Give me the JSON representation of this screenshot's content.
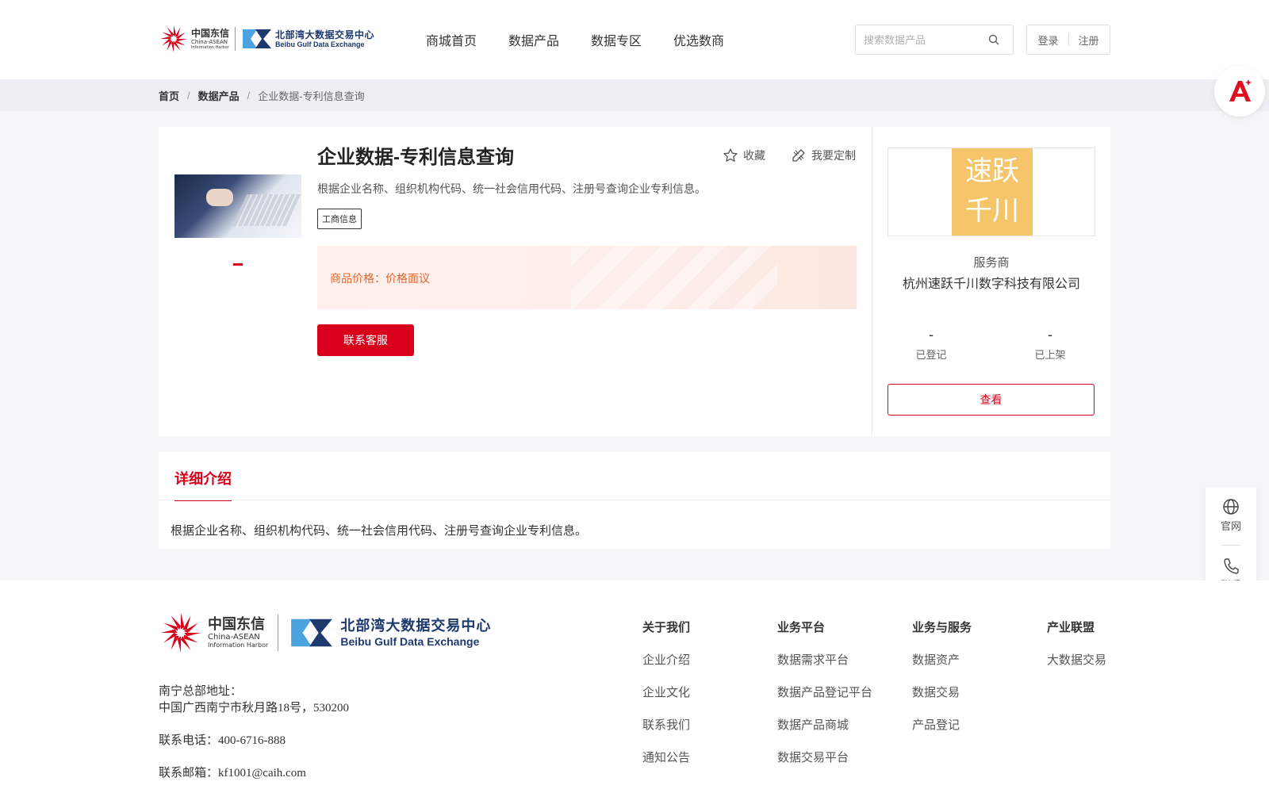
{
  "header": {
    "logo_cn": "中国东信",
    "logo_cn_sub": "China-ASEAN",
    "logo_cn_sub2": "Information Harbor",
    "logo_bb": "北部湾大数据交易中心",
    "logo_bb_en": "Beibu Gulf Data Exchange",
    "nav": [
      "商城首页",
      "数据产品",
      "数据专区",
      "优选数商"
    ],
    "search_placeholder": "搜索数据产品",
    "login": "登录",
    "register": "注册"
  },
  "breadcrumb": [
    "首页",
    "数据产品",
    "企业数据-专利信息查询"
  ],
  "product": {
    "title": "企业数据-专利信息查询",
    "favorite": "收藏",
    "customize": "我要定制",
    "description": "根据企业名称、组织机构代码、统一社会信用代码、注册号查询企业专利信息。",
    "tag": "工商信息",
    "price_label": "商品价格：",
    "price_value": "价格面议",
    "contact_button": "联系客服"
  },
  "provider": {
    "logo_line1": "速跃",
    "logo_line2": "千川",
    "label": "服务商",
    "name": "杭州速跃千川数字科技有限公司",
    "registered_value": "-",
    "registered_label": "已登记",
    "listed_value": "-",
    "listed_label": "已上架",
    "view_button": "查看"
  },
  "detail": {
    "tab": "详细介绍",
    "text": "根据企业名称、组织机构代码、统一社会信用代码、注册号查询企业专利信息。"
  },
  "side": {
    "website": "官网",
    "contact": "联系"
  },
  "footer": {
    "address_label": "南宁总部地址：",
    "address": "中国广西南宁市秋月路18号，530200",
    "phone": "联系电话：400-6716-888",
    "email": "联系邮箱：kf1001@caih.com",
    "columns": [
      {
        "title": "关于我们",
        "items": [
          "企业介绍",
          "企业文化",
          "联系我们",
          "通知公告"
        ]
      },
      {
        "title": "业务平台",
        "items": [
          "数据需求平台",
          "数据产品登记平台",
          "数据产品商城",
          "数据交易平台"
        ]
      },
      {
        "title": "业务与服务",
        "items": [
          "数据资产",
          "数据交易",
          "产品登记"
        ]
      },
      {
        "title": "产业联盟",
        "items": [
          "大数据交易"
        ]
      }
    ]
  },
  "colors": {
    "accent": "#d9001b",
    "price": "#e5652c",
    "brand_blue": "#1d3a6e",
    "provider_logo_bg": "#f6c56a"
  }
}
